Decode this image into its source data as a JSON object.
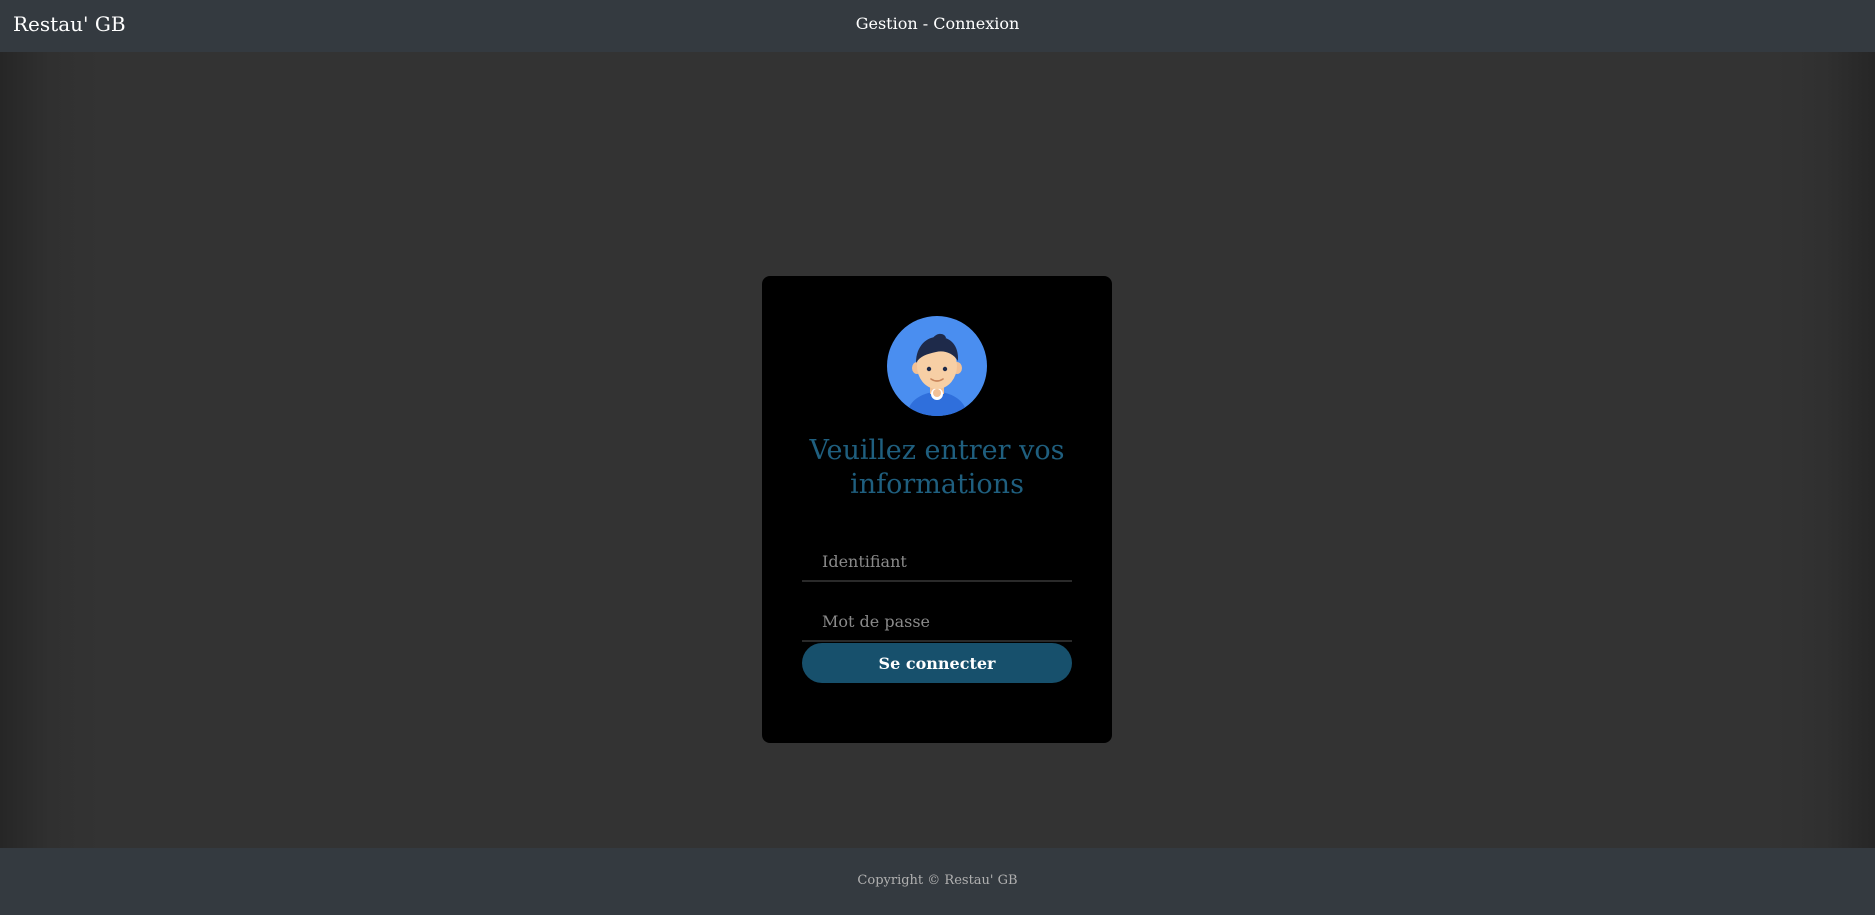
{
  "header": {
    "brand": "Restau' GB",
    "page_title": "Gestion - Connexion"
  },
  "login": {
    "avatar_icon": "user-avatar-icon",
    "title": "Veuillez entrer vos informations",
    "username_placeholder": "Identifiant",
    "username_value": "",
    "password_placeholder": "Mot de passe",
    "password_value": "",
    "submit_label": "Se connecter"
  },
  "footer": {
    "copyright": "Copyright © Restau' GB"
  },
  "colors": {
    "navbar": "#343a40",
    "page_background": "#333333",
    "card_background": "#000000",
    "title": "#1f5f7f",
    "button": "#17506c",
    "avatar_circle": "#4a8ef0"
  }
}
